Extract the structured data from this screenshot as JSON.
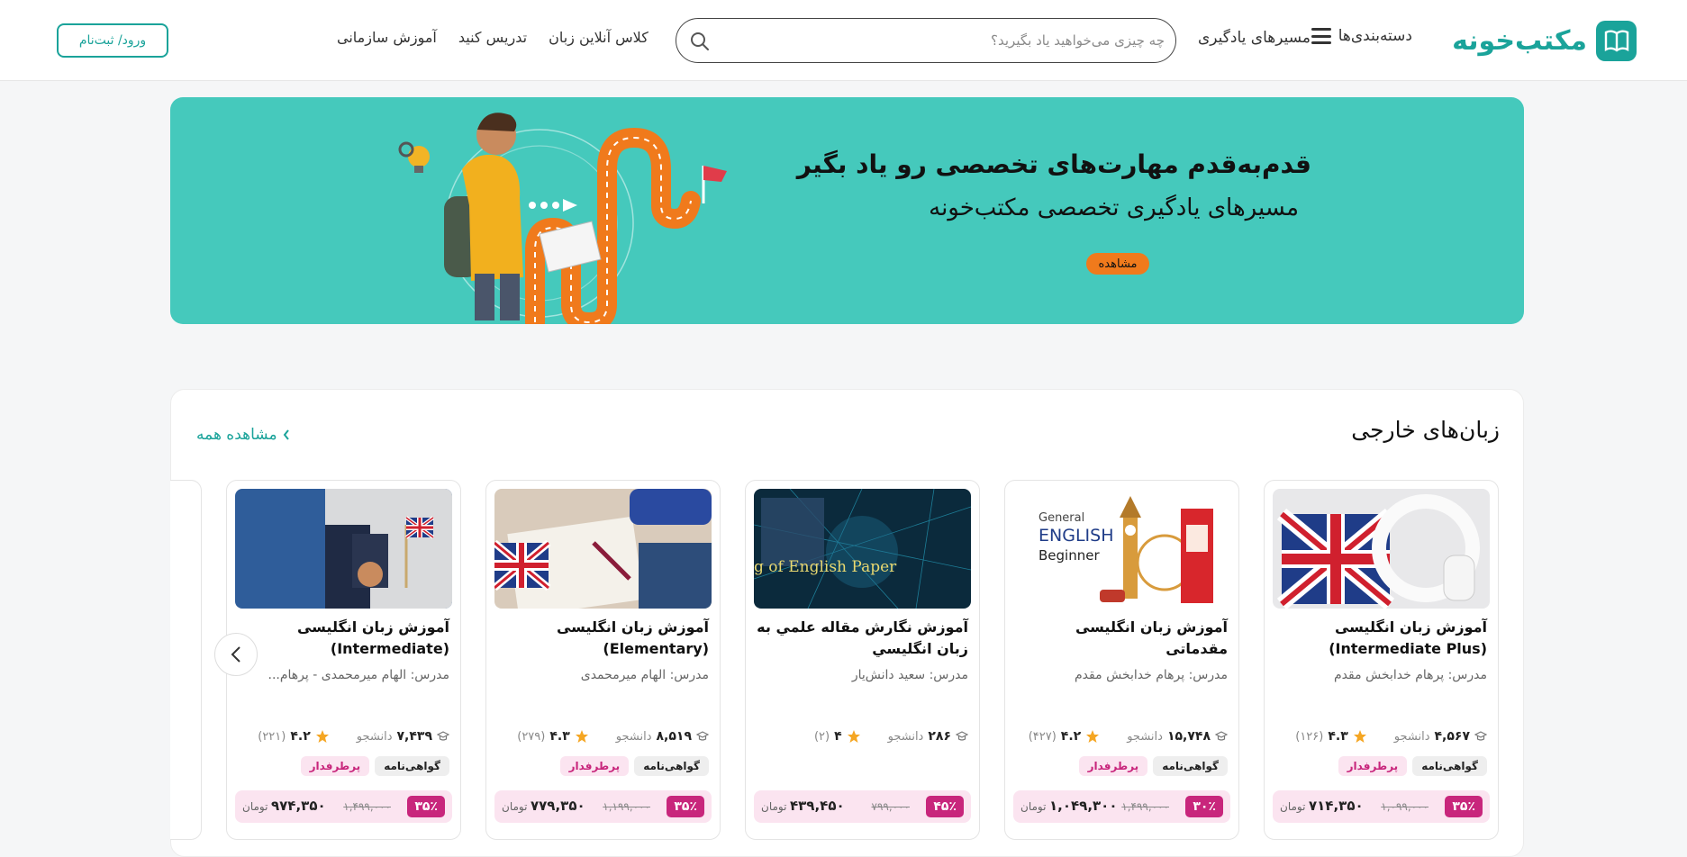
{
  "header": {
    "logo_text": "مکتب‌خونه",
    "categories_label": "دسته‌بندی‌ها",
    "paths_label": "مسیرهای یادگیری",
    "search_placeholder": "چه چیزی می‌خواهید یاد بگیرید؟",
    "links": [
      "آموزش سازمانی",
      "تدریس کنید",
      "کلاس آنلاین زبان"
    ],
    "login_label": "ورود/ ثبت‌نام"
  },
  "banner": {
    "title": "قدم‌به‌قدم مهارت‌های تخصصی رو یاد بگیر",
    "subtitle": "مسیرهای یادگیری تخصصی مکتب‌خونه",
    "button_label": "مشاهده"
  },
  "section": {
    "title": "زبان‌های خارجی",
    "view_all": "مشاهده همه"
  },
  "labels": {
    "students": "دانشجو",
    "popular": "پرطرفدار",
    "certificate": "گواهی‌نامه",
    "currency": "تومان"
  },
  "courses": [
    {
      "title": "آموزش زبان انگلیسی (Intermediate Plus)",
      "teacher": "مدرس: پرهام خدابخش مقدم",
      "students": "۴,۵۶۷",
      "rating": "۴.۳",
      "reviews": "(۱۲۶)",
      "discount": "۳۵٪",
      "old_price": "۱,۰۹۹,۰۰۰",
      "price": "۷۱۴,۳۵۰"
    },
    {
      "title": "آموزش زبان انگلیسی مقدماتی",
      "teacher": "مدرس: پرهام خدابخش مقدم",
      "students": "۱۵,۷۴۸",
      "rating": "۴.۲",
      "reviews": "(۴۲۷)",
      "discount": "۳۰٪",
      "old_price": "۱,۴۹۹,۰۰۰",
      "price": "۱,۰۴۹,۳۰۰"
    },
    {
      "title": "آموزش نگارش مقاله علمي به زبان انگليسي",
      "teacher": "مدرس: سعید دانش‌یار",
      "students": "۲۸۶",
      "rating": "۴",
      "reviews": "(۲)",
      "discount": "۴۵٪",
      "old_price": "۷۹۹,۰۰۰",
      "price": "۴۳۹,۴۵۰"
    },
    {
      "title": "آموزش زبان انگلیسی (Elementary)",
      "teacher": "مدرس: الهام میرمحمدی",
      "students": "۸,۵۱۹",
      "rating": "۴.۳",
      "reviews": "(۲۷۹)",
      "discount": "۳۵٪",
      "old_price": "۱,۱۹۹,۰۰۰",
      "price": "۷۷۹,۳۵۰"
    },
    {
      "title": "آموزش زبان انگلیسی (Intermediate)",
      "teacher": "مدرس: الهام میرمحمدی - پرهام...",
      "students": "۷,۴۳۹",
      "rating": "۴.۲",
      "reviews": "(۲۲۱)",
      "discount": "۳۵٪",
      "old_price": "۱,۴۹۹,۰۰۰",
      "price": "۹۷۴,۳۵۰"
    }
  ],
  "colors": {
    "accent": "#1aa39a",
    "banner": "#45c9bc",
    "pink": "#c8267c",
    "orange": "#f07a1c"
  }
}
